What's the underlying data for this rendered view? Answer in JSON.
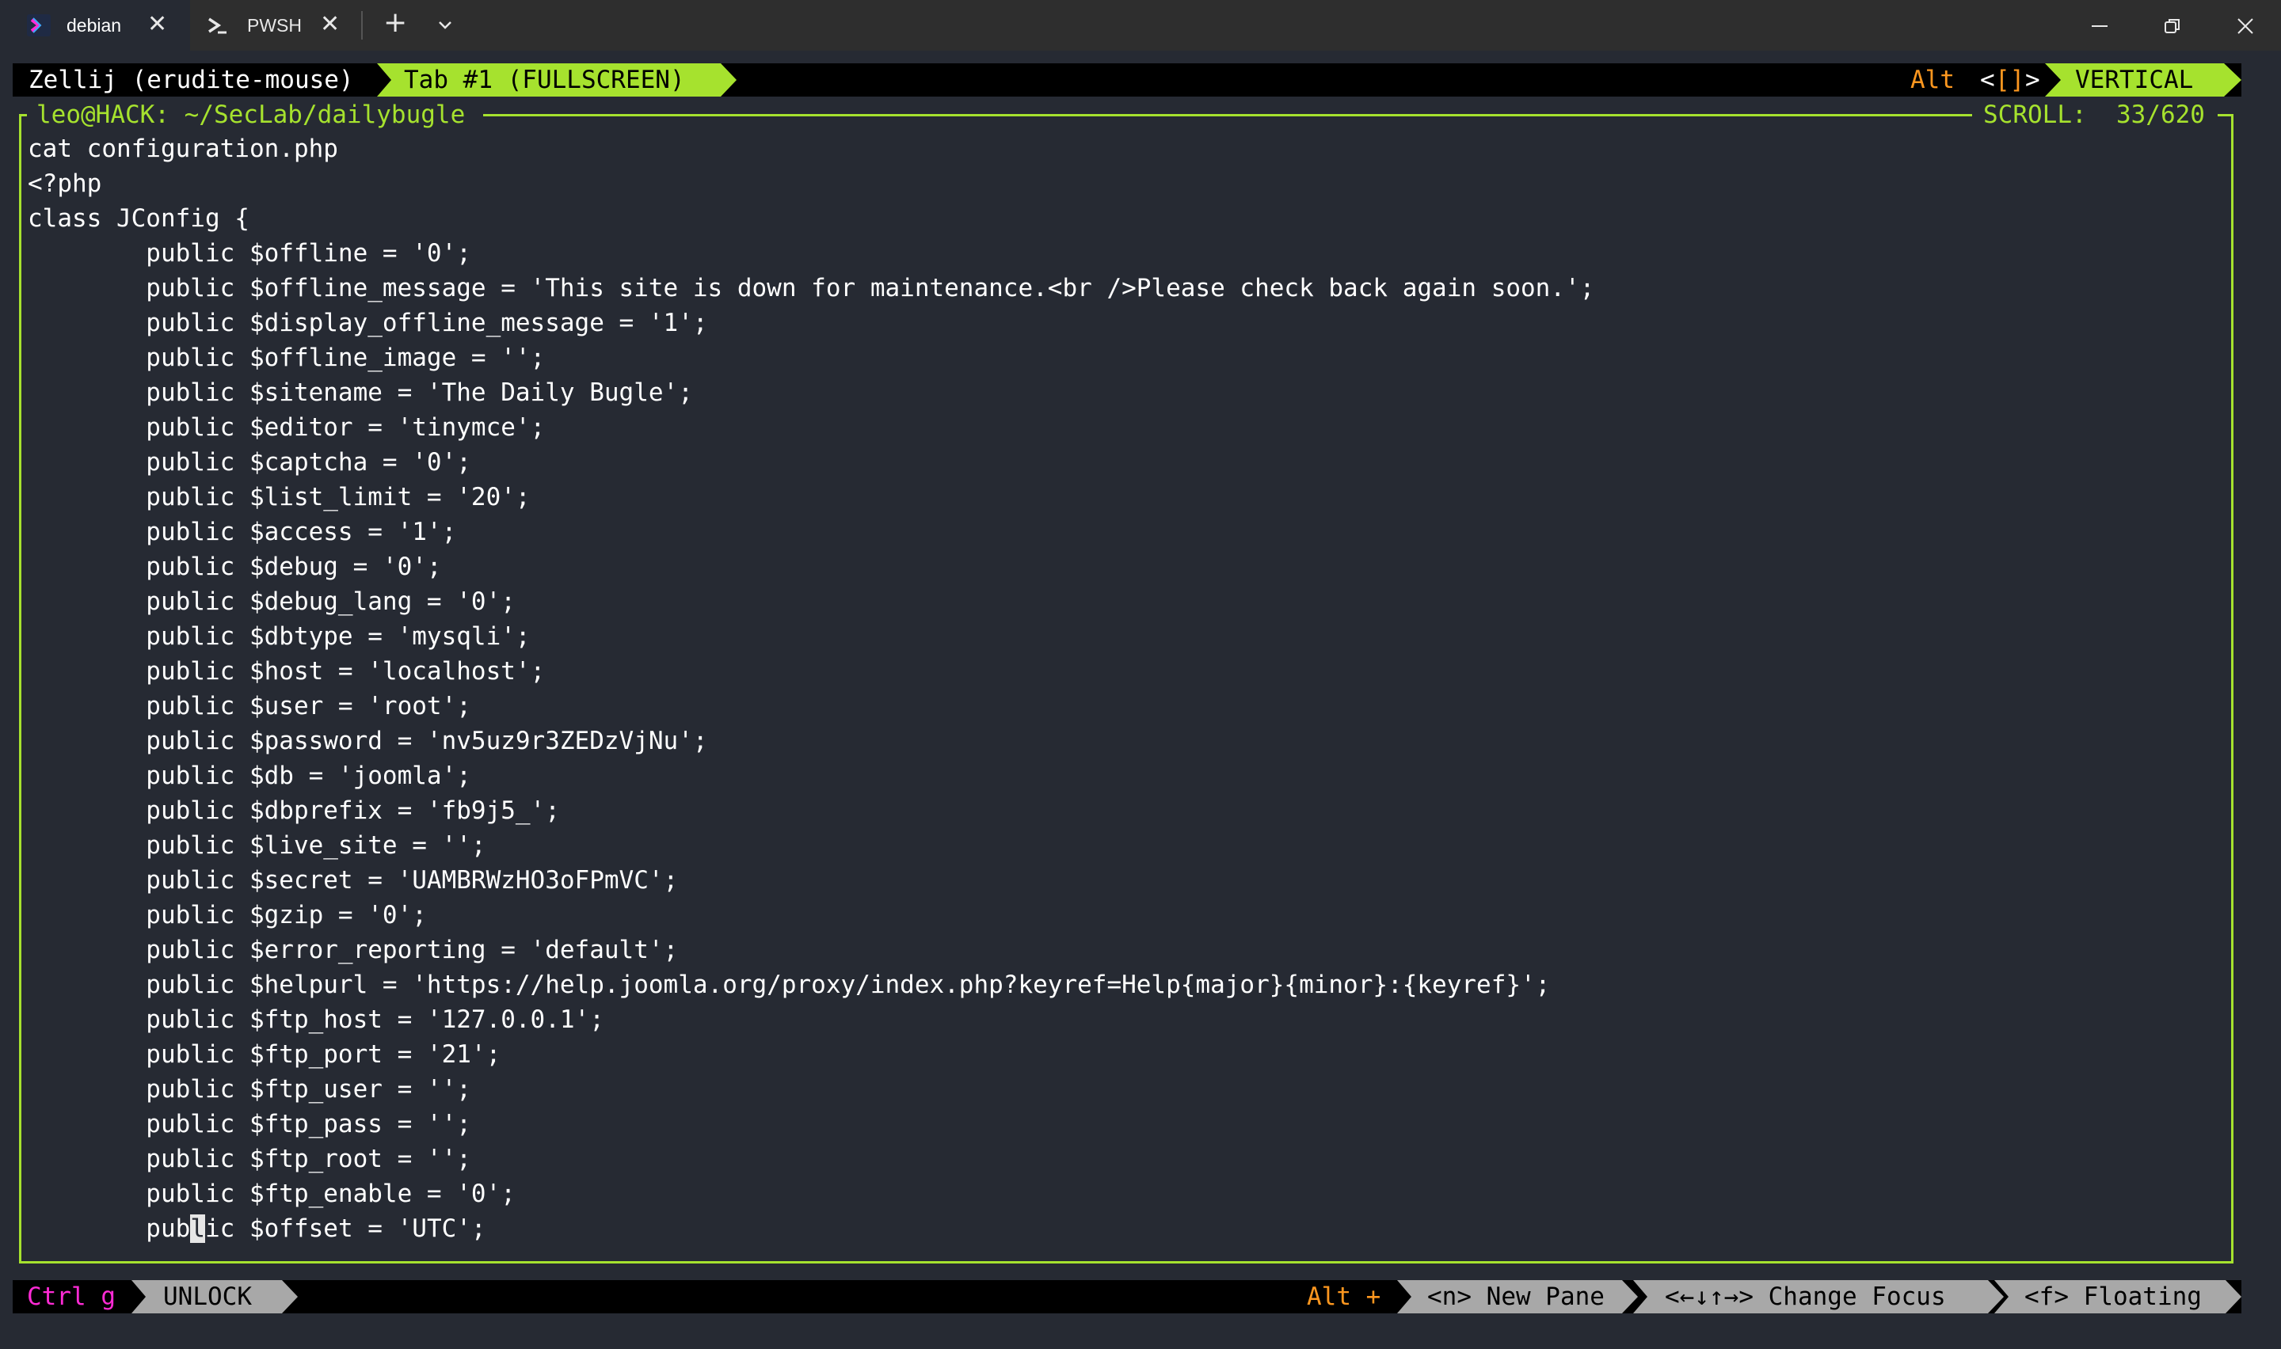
{
  "window": {
    "tabs": [
      {
        "label": "debian",
        "icon": "debian-terminal-icon",
        "active": true
      },
      {
        "label": "PWSH",
        "icon": "powershell-icon",
        "active": false
      }
    ],
    "new_tab_glyph": "+",
    "close_glyph": "✕"
  },
  "zellij": {
    "session_label": "Zellij (erudite-mouse)",
    "tab_label": "Tab #1 (FULLSCREEN)",
    "mode_hint_key": "Alt",
    "mode_hint_brackets": "[]",
    "layout_label": "VERTICAL",
    "pane_title": "leo@HACK: ~/SecLab/dailybugle",
    "scroll_label": "SCROLL:",
    "scroll_value": "33/620",
    "bottom": {
      "ctrl_key": "Ctrl g",
      "unlock_label": "UNLOCK",
      "alt_key": "Alt +",
      "new_pane": "<n> New Pane",
      "change_focus": "<←↓↑→> Change Focus",
      "floating": "<f> Floating"
    },
    "colors": {
      "accent": "#a6e22e",
      "orange": "#fd971f",
      "magenta": "#ff2bd6",
      "gray": "#a8a8a8"
    }
  },
  "terminal": {
    "lines": [
      "cat configuration.php",
      "<?php",
      "class JConfig {",
      "        public $offline = '0';",
      "        public $offline_message = 'This site is down for maintenance.<br />Please check back again soon.';",
      "        public $display_offline_message = '1';",
      "        public $offline_image = '';",
      "        public $sitename = 'The Daily Bugle';",
      "        public $editor = 'tinymce';",
      "        public $captcha = '0';",
      "        public $list_limit = '20';",
      "        public $access = '1';",
      "        public $debug = '0';",
      "        public $debug_lang = '0';",
      "        public $dbtype = 'mysqli';",
      "        public $host = 'localhost';",
      "        public $user = 'root';",
      "        public $password = 'nv5uz9r3ZEDzVjNu';",
      "        public $db = 'joomla';",
      "        public $dbprefix = 'fb9j5_';",
      "        public $live_site = '';",
      "        public $secret = 'UAMBRWzHO3oFPmVC';",
      "        public $gzip = '0';",
      "        public $error_reporting = 'default';",
      "        public $helpurl = 'https://help.joomla.org/proxy/index.php?keyref=Help{major}{minor}:{keyref}';",
      "        public $ftp_host = '127.0.0.1';",
      "        public $ftp_port = '21';",
      "        public $ftp_user = '';",
      "        public $ftp_pass = '';",
      "        public $ftp_root = '';",
      "        public $ftp_enable = '0';"
    ],
    "cursor_line": {
      "before": "        pub",
      "cursor": "l",
      "after": "ic $offset = 'UTC';"
    }
  }
}
